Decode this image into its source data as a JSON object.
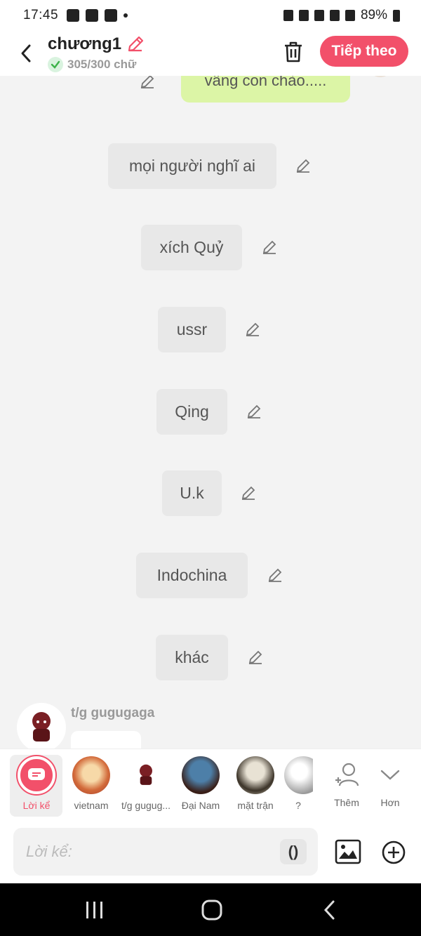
{
  "status_bar": {
    "time": "17:45",
    "battery": "89%"
  },
  "header": {
    "chapter_title": "chương1",
    "word_count": "305/300 chữ",
    "next_label": "Tiếp theo"
  },
  "chat": {
    "top_green_text": "vâng con chào.....",
    "narration": [
      "mọi người nghĩ ai",
      "xích Quỷ",
      "ussr",
      "Qing",
      "U.k",
      "Indochina",
      "khác"
    ],
    "character_name": "t/g gugugaga"
  },
  "selector": {
    "items": [
      {
        "label": "Lời kể"
      },
      {
        "label": "vietnam"
      },
      {
        "label": "t/g gugug..."
      },
      {
        "label": "Đại Nam"
      },
      {
        "label": "mặt trận"
      },
      {
        "label": "?"
      },
      {
        "label": "Thêm"
      },
      {
        "label": "Hơn"
      }
    ]
  },
  "input": {
    "placeholder": "Lời kể:",
    "paren_label": "()"
  },
  "colors": {
    "accent": "#f2506a",
    "green_bubble": "#dcf5a6",
    "check_green": "#3cb34a"
  },
  "icons": [
    "back-arrow-icon",
    "pencil-icon",
    "check-icon",
    "trash-icon",
    "chat-icon",
    "add-person-icon",
    "chevron-down-icon",
    "image-icon",
    "plus-circle-icon"
  ]
}
